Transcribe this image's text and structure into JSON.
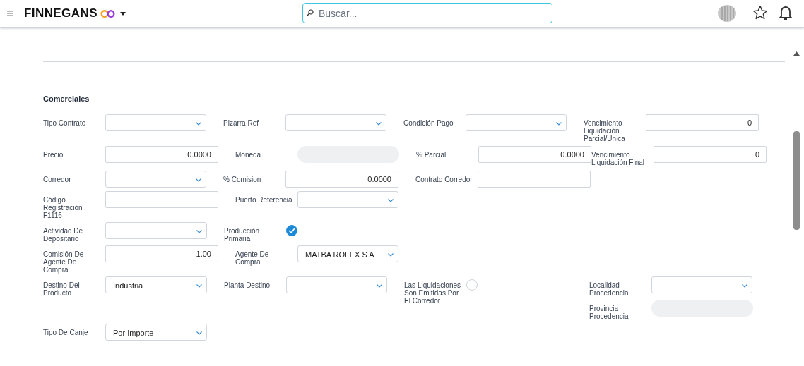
{
  "header": {
    "app_name": "FINNEGANS",
    "search_placeholder": "Buscar..."
  },
  "section_title": "Comerciales",
  "rows": [
    [
      {
        "label": "Tipo Contrato",
        "kind": "select"
      },
      {
        "label": "Pizarra Ref",
        "kind": "select"
      },
      {
        "label": "Condición Pago",
        "kind": "select"
      },
      {
        "label": "Vencimiento Liquidación Parcial/Unica",
        "kind": "input",
        "value": "0"
      }
    ],
    [
      {
        "label": "Precio",
        "kind": "input",
        "value": "0.0000"
      },
      {
        "label": "Moneda",
        "kind": "disabled"
      },
      {
        "label": "% Parcial",
        "kind": "input",
        "value": "0.0000"
      },
      {
        "label": "Vencimiento Liquidación Final",
        "kind": "input",
        "value": "0"
      }
    ],
    [
      {
        "label": "Corredor",
        "kind": "select"
      },
      {
        "label": "% Comision",
        "kind": "input",
        "value": "0.0000"
      },
      {
        "label": "Contrato Corredor",
        "kind": "input"
      }
    ],
    [
      {
        "label": "Código Registración F1116",
        "kind": "input"
      },
      {
        "label": "Puerto Referencia",
        "kind": "select"
      }
    ],
    [
      {
        "label": "Actividad De Depositario",
        "kind": "select"
      },
      {
        "label": "Producción Primaria",
        "kind": "check",
        "checked": true
      }
    ],
    [
      {
        "label": "Comisión De Agente De Compra",
        "kind": "input",
        "value": "1.00"
      },
      {
        "label": "Agente De Compra",
        "kind": "select",
        "value": "MATBA ROFEX S A"
      }
    ],
    [
      {
        "label": "Destino Del Producto",
        "kind": "select",
        "value": "Industria"
      },
      {
        "label": "Planta Destino",
        "kind": "select"
      },
      {
        "label": "Las Liquidaciones Son Emitidas Por El Corredor",
        "kind": "check",
        "checked": false
      },
      {
        "label": "Localidad Procedencia",
        "kind": "select"
      }
    ],
    [
      {
        "label": "Provincia Procedencia",
        "kind": "disabled"
      }
    ],
    [
      {
        "label": "Tipo De Canje",
        "kind": "select",
        "value": "Por Importe"
      }
    ]
  ]
}
